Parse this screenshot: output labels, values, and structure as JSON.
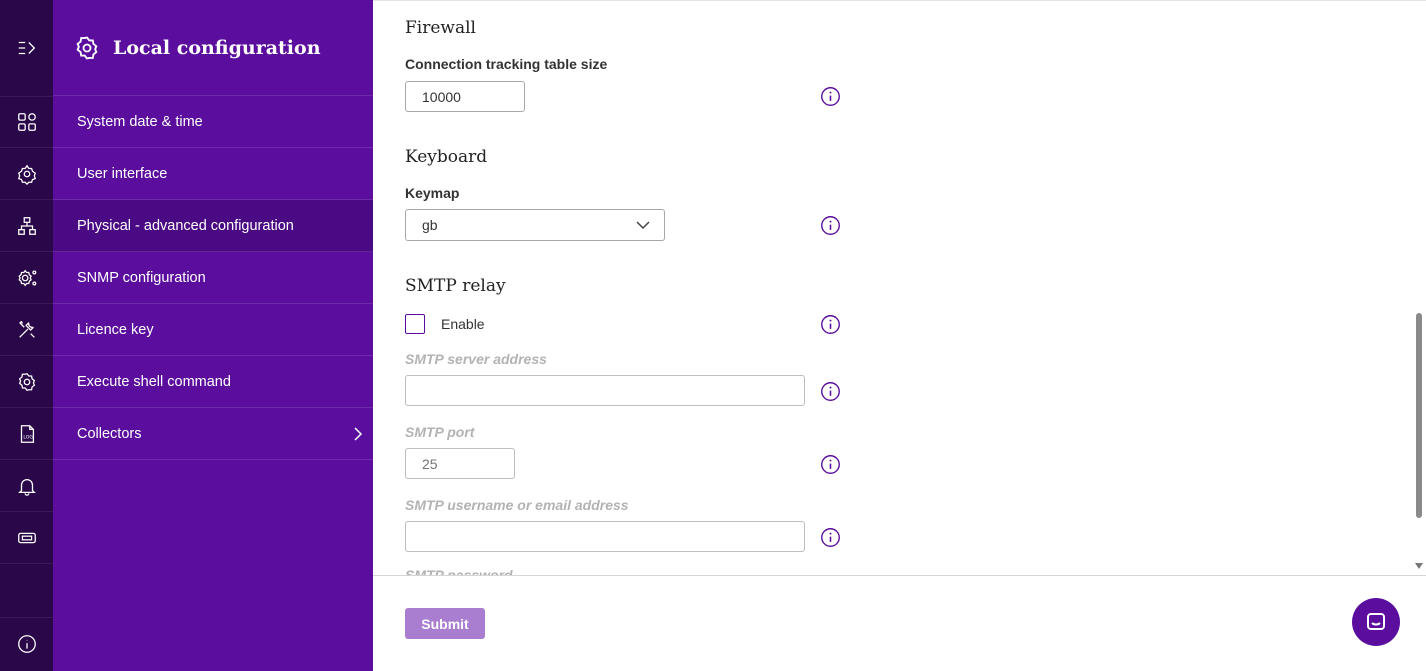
{
  "sidebar": {
    "title": "Local configuration",
    "items": [
      {
        "label": "System date & time",
        "active": false
      },
      {
        "label": "User interface",
        "active": false
      },
      {
        "label": "Physical - advanced configuration",
        "active": true
      },
      {
        "label": "SNMP configuration",
        "active": false
      },
      {
        "label": "Licence key",
        "active": false
      },
      {
        "label": "Execute shell command",
        "active": false
      },
      {
        "label": "Collectors",
        "active": false
      }
    ]
  },
  "rail": {
    "icons": [
      "expand-menu-icon",
      "dashboard-grid-icon",
      "settings-network-icon",
      "hierarchy-icon",
      "gear-network-icon",
      "tools-icon",
      "gear-icon",
      "log-file-icon",
      "bell-icon",
      "ticket-icon",
      "info-icon"
    ]
  },
  "firewall": {
    "title": "Firewall",
    "conntrack_label": "Connection tracking table size",
    "conntrack_value": "10000"
  },
  "keyboard": {
    "title": "Keyboard",
    "keymap_label": "Keymap",
    "keymap_value": "gb"
  },
  "smtp": {
    "title": "SMTP relay",
    "enable_label": "Enable",
    "enabled": false,
    "server_label": "SMTP server address",
    "server_value": "",
    "port_label": "SMTP port",
    "port_placeholder": "25",
    "username_label": "SMTP username or email address",
    "username_value": "",
    "password_label": "SMTP password"
  },
  "footer": {
    "submit_label": "Submit"
  },
  "colors": {
    "rail": "#2a0748",
    "panel": "#5b0e9e",
    "active_item": "#4a0a84",
    "submit": "#a97ed1",
    "accent": "#5b0e9e"
  }
}
